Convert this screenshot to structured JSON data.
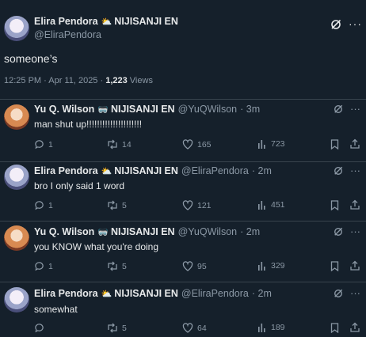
{
  "main_post": {
    "display_name": "Elira Pendora",
    "emoji": "⛅",
    "affiliation": "NIJISANJI EN",
    "handle": "@EliraPendora",
    "text": "someone’s",
    "time": "12:25 PM · Apr 11, 2025 · ",
    "views_count": "1,223",
    "views_label": "Views"
  },
  "replies": [
    {
      "display_name": "Yu Q. Wilson",
      "emoji": "🥽",
      "affiliation": "NIJISANJI EN",
      "handle": "@YuQWilson",
      "age": "· 3m",
      "text": "man shut up!!!!!!!!!!!!!!!!!!!!!",
      "replies": "1",
      "reposts": "14",
      "likes": "165",
      "views": "723"
    },
    {
      "display_name": "Elira Pendora",
      "emoji": "⛅",
      "affiliation": "NIJISANJI EN",
      "handle": "@EliraPendora",
      "age": "· 2m",
      "text": "bro I only said 1 word",
      "replies": "1",
      "reposts": "5",
      "likes": "121",
      "views": "451"
    },
    {
      "display_name": "Yu Q. Wilson",
      "emoji": "🥽",
      "affiliation": "NIJISANJI EN",
      "handle": "@YuQWilson",
      "age": "· 2m",
      "text": "you KNOW what you're doing",
      "replies": "1",
      "reposts": "5",
      "likes": "95",
      "views": "329"
    },
    {
      "display_name": "Elira Pendora",
      "emoji": "⛅",
      "affiliation": "NIJISANJI EN",
      "handle": "@EliraPendora",
      "age": "· 2m",
      "text": "somewhat",
      "replies": "",
      "reposts": "5",
      "likes": "64",
      "views": "189"
    }
  ]
}
